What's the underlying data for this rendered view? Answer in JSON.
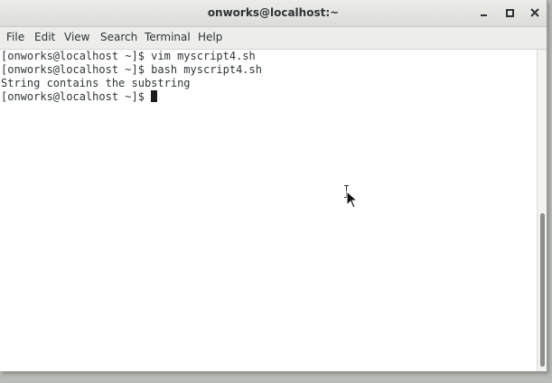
{
  "window": {
    "title": "onworks@localhost:~"
  },
  "menu": {
    "items": [
      "File",
      "Edit",
      "View",
      "Search",
      "Terminal",
      "Help"
    ]
  },
  "terminal": {
    "lines": [
      "[onworks@localhost ~]$ vim myscript4.sh",
      "[onworks@localhost ~]$ bash myscript4.sh",
      "String contains the substring"
    ],
    "prompt": "[onworks@localhost ~]$ "
  },
  "icons": {
    "minimize": "minimize-icon",
    "maximize": "maximize-icon",
    "close": "close-icon",
    "text_cursor": "text-cursor-icon",
    "mouse_pointer": "mouse-pointer-icon"
  },
  "colors": {
    "titlebar": "#e3e3e0",
    "menubar": "#ededeb",
    "terminal_bg": "#ffffff",
    "terminal_fg": "#2e3436",
    "cursor": "#1d1d1d"
  }
}
